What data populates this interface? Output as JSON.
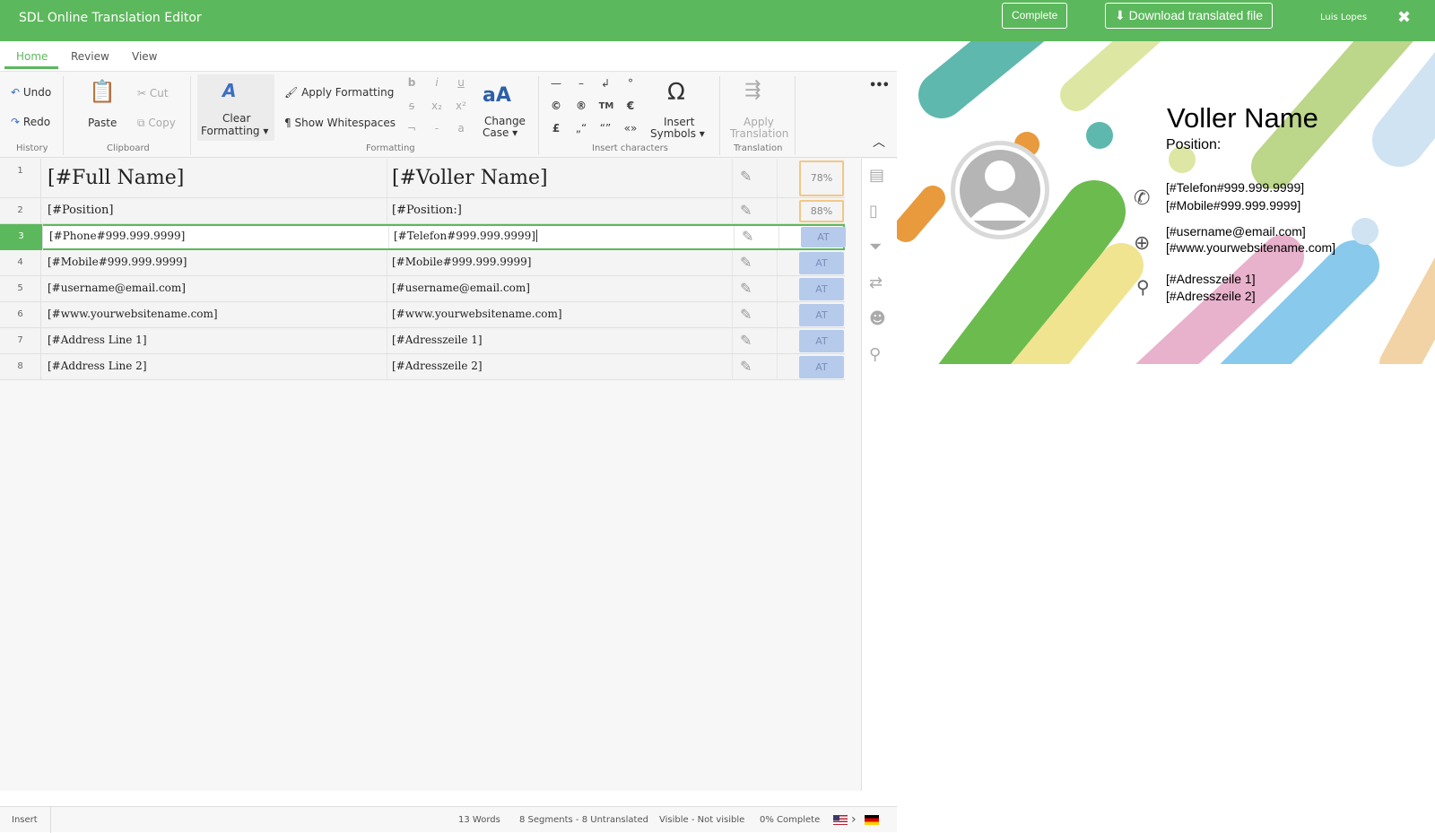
{
  "app": {
    "title": "SDL Online Translation Editor",
    "complete": "Complete",
    "download": "Download translated file",
    "user": "Luis Lopes",
    "close": "✖"
  },
  "tabs": {
    "home": "Home",
    "review": "Review",
    "view": "View"
  },
  "ribbon": {
    "undo": "Undo",
    "redo": "Redo",
    "history": "History",
    "paste": "Paste",
    "cut": "Cut",
    "copy": "Copy",
    "clipboard": "Clipboard",
    "clear_formatting_1": "Clear",
    "clear_formatting_2": "Formatting ▾",
    "apply_formatting": "Apply Formatting",
    "show_whitespaces": "Show Whitespaces",
    "formatting": "Formatting",
    "change_case_1": "Change",
    "change_case_2": "Case ▾",
    "insert_symbols_1": "Insert",
    "insert_symbols_2": "Symbols ▾",
    "insert_characters": "Insert characters",
    "apply_translation_1": "Apply",
    "apply_translation_2": "Translation",
    "translation": "Translation",
    "more": "•••",
    "collapse": "︿"
  },
  "format_chars": [
    "b",
    "i",
    "u",
    "s",
    "x₂",
    "x²",
    "¬",
    "-",
    "a"
  ],
  "insert_chars": [
    "—",
    "–",
    "↲",
    "°",
    "©",
    "®",
    "TM",
    "€",
    "£",
    "„“",
    "“”",
    "«»"
  ],
  "segments": [
    {
      "num": "1",
      "source": "[#Full Name]",
      "target": "[#Voller Name]",
      "status": "78%"
    },
    {
      "num": "2",
      "source": "[#Position]",
      "target": "[#Position:]",
      "status": "88%"
    },
    {
      "num": "3",
      "source": "[#Phone#999.999.9999]",
      "target": "[#Telefon#999.999.9999]",
      "status": "AT"
    },
    {
      "num": "4",
      "source": "[#Mobile#999.999.9999]",
      "target": "[#Mobile#999.999.9999]",
      "status": "AT"
    },
    {
      "num": "5",
      "source": "[#username@email.com]",
      "target": "[#username@email.com]",
      "status": "AT"
    },
    {
      "num": "6",
      "source": "[#www.yourwebsitename.com]",
      "target": "[#www.yourwebsitename.com]",
      "status": "AT"
    },
    {
      "num": "7",
      "source": "[#Address Line 1]",
      "target": "[#Adresszeile 1]",
      "status": "AT"
    },
    {
      "num": "8",
      "source": "[#Address Line 2]",
      "target": "[#Adresszeile 2]",
      "status": "AT"
    }
  ],
  "statusbar": {
    "mode": "Insert",
    "words": "13 Words",
    "segments": "8 Segments - 8 Untranslated",
    "visible": "Visible - Not visible",
    "complete": "0% Complete"
  },
  "card": {
    "name": "Voller Name",
    "position": "Position:",
    "phone": "[#Telefon#999.999.9999]",
    "mobile": "[#Mobile#999.999.9999]",
    "email": "[#username@email.com]",
    "web": "[#www.yourwebsitename.com]",
    "addr1": "[#Adresszeile 1]",
    "addr2": "[#Adresszeile 2]"
  },
  "colors": {
    "accent": "#5cb85c",
    "at_status": "#b6cbec",
    "fuzzy_border": "#f0c887"
  }
}
